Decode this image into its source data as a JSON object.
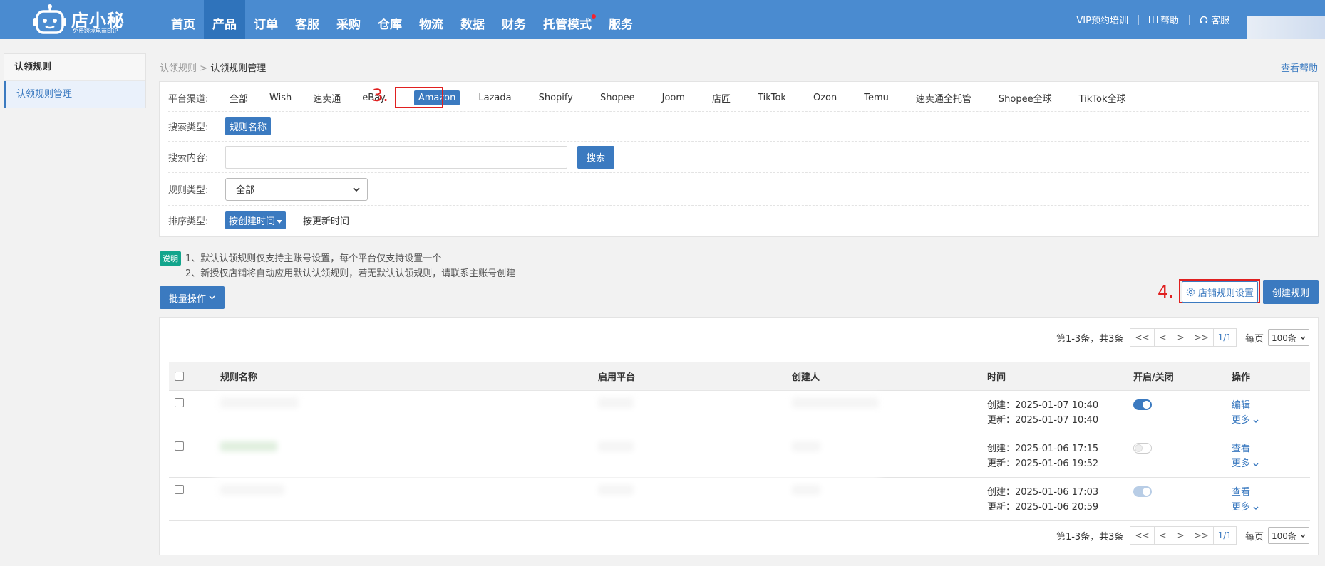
{
  "brand": {
    "name": "店小秘",
    "subtitle": "免费跨境电商ERP"
  },
  "nav": [
    {
      "label": "首页"
    },
    {
      "label": "产品"
    },
    {
      "label": "订单"
    },
    {
      "label": "客服"
    },
    {
      "label": "采购"
    },
    {
      "label": "仓库"
    },
    {
      "label": "物流"
    },
    {
      "label": "数据"
    },
    {
      "label": "财务"
    },
    {
      "label": "托管模式"
    },
    {
      "label": "服务"
    }
  ],
  "topright": {
    "vip": "VIP预约培训",
    "help": "帮助",
    "service": "客服"
  },
  "sidebar": {
    "title": "认领规则",
    "item": "认领规则管理"
  },
  "breadcrumb": {
    "parent": "认领规则",
    "sep": ">",
    "current": "认领规则管理"
  },
  "help_link": "查看帮助",
  "filter": {
    "platform_label": "平台渠道:",
    "platforms": [
      "全部",
      "Wish",
      "速卖通",
      "eBay",
      "Amazon",
      "Lazada",
      "Shopify",
      "Shopee",
      "Joom",
      "店匠",
      "TikTok",
      "Ozon",
      "Temu",
      "速卖通全托管",
      "Shopee全球",
      "TikTok全球"
    ],
    "search_type_label": "搜索类型:",
    "search_type_value": "规则名称",
    "search_content_label": "搜索内容:",
    "search_placeholder": "",
    "search_button": "搜索",
    "rule_type_label": "规则类型:",
    "rule_type_value": "全部",
    "sort_label": "排序类型:",
    "sort_active": "按创建时间",
    "sort_other": "按更新时间"
  },
  "annotations": {
    "three": "3.",
    "four": "4."
  },
  "notes": {
    "tag": "说明",
    "line1": "1、默认认领规则仅支持主账号设置，每个平台仅支持设置一个",
    "line2": "2、新授权店铺将自动应用默认认领规则，若无默认认领规则，请联系主账号创建"
  },
  "actions": {
    "batch": "批量操作",
    "shop_rule": "店铺规则设置",
    "create": "创建规则"
  },
  "pager": {
    "summary": "第1-3条，共3条",
    "first": "<<",
    "prev": "<",
    "next": ">",
    "last": ">>",
    "page": "1/1",
    "per_label": "每页",
    "per_value": "100条"
  },
  "table": {
    "headers": {
      "name": "规则名称",
      "platform": "启用平台",
      "creator": "创建人",
      "time": "时间",
      "toggle": "开启/关闭",
      "ops": "操作"
    },
    "rows": [
      {
        "created": "创建：2025-01-07 10:40",
        "updated": "更新：2025-01-07 10:40",
        "toggle": "on",
        "op1": "编辑",
        "op2": "更多"
      },
      {
        "created": "创建：2025-01-06 17:15",
        "updated": "更新：2025-01-06 19:52",
        "toggle": "off",
        "op1": "查看",
        "op2": "更多"
      },
      {
        "created": "创建：2025-01-06 17:03",
        "updated": "更新：2025-01-06 20:59",
        "toggle": "disabled",
        "op1": "查看",
        "op2": "更多"
      }
    ]
  },
  "colors": {
    "primary": "#3b7ac0",
    "topbar": "#4a8bd0",
    "annotation": "#e02020",
    "note_tag": "#12a58c"
  }
}
